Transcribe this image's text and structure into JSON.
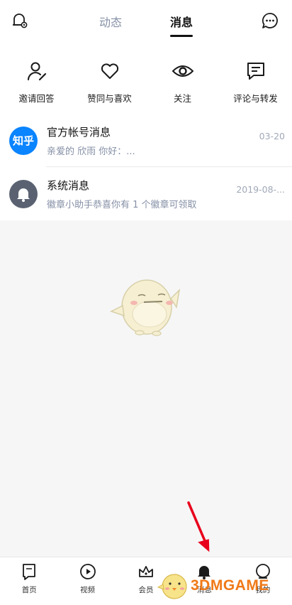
{
  "header": {
    "tabs": [
      {
        "label": "动态",
        "active": false
      },
      {
        "label": "消息",
        "active": true
      }
    ],
    "left_icon": "bell-settings-icon",
    "right_icon": "chat-bubble-icon"
  },
  "categories": [
    {
      "label": "邀请回答",
      "icon": "person-pen-icon"
    },
    {
      "label": "赞同与喜欢",
      "icon": "heart-icon"
    },
    {
      "label": "关注",
      "icon": "eye-icon"
    },
    {
      "label": "评论与转发",
      "icon": "comment-icon"
    }
  ],
  "messages": [
    {
      "title": "官方帐号消息",
      "subtitle": "亲爱的 欣雨 你好：...",
      "time": "03-20",
      "avatar_text": "知乎",
      "avatar_color": "#0a84ff"
    },
    {
      "title": "系统消息",
      "subtitle": "徽章小助手恭喜你有 1 个徽章可领取",
      "time": "2019-08-...",
      "avatar_icon": "bell-icon",
      "avatar_color": "#5a6272"
    }
  ],
  "bottom_nav": [
    {
      "label": "首页",
      "icon": "home-bookmark-icon"
    },
    {
      "label": "视频",
      "icon": "play-icon"
    },
    {
      "label": "会员",
      "icon": "crown-icon"
    },
    {
      "label": "消息",
      "icon": "bell-icon",
      "active": true
    },
    {
      "label": "我的",
      "icon": "profile-circle-icon"
    }
  ],
  "watermark": {
    "text": "3DMGAME"
  },
  "colors": {
    "accent": "#0a84ff",
    "arrow": "#e8001c",
    "watermark": "#f07a18"
  }
}
